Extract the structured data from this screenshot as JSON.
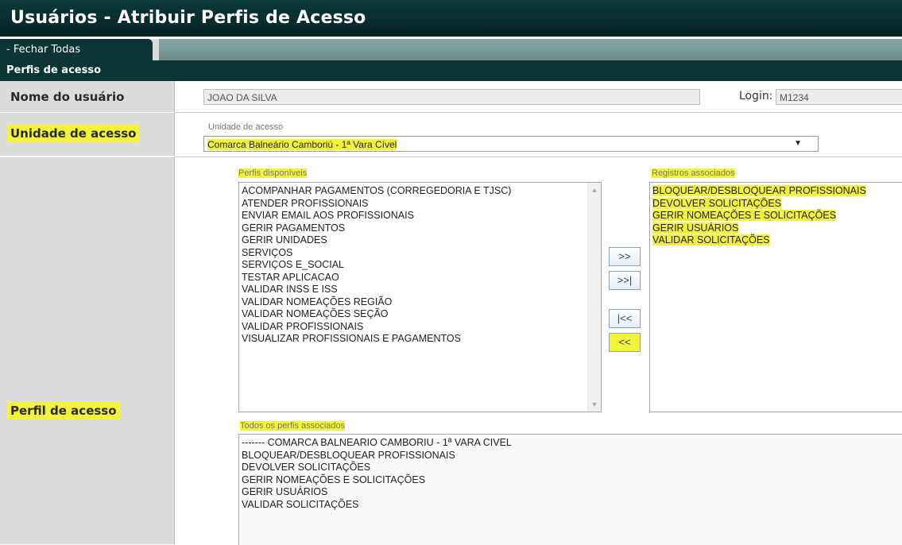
{
  "window": {
    "title": "Usuários - Atribuir Perfis de Acesso"
  },
  "tabs": {
    "close_all": "- Fechar Todas"
  },
  "section": {
    "title": "Perfis de acesso"
  },
  "form": {
    "user_name_label": "Nome do usuário",
    "user_name_value": "JOAO DA SILVA",
    "login_label": "Login:",
    "login_value": "M1234",
    "unit_label": "Unidade de acesso",
    "unit_small_label": "Unidade de acesso",
    "unit_selected": "Comarca Balneário Camboriú - 1ª Vara Cível",
    "profile_label": "Perfil de acesso"
  },
  "available": {
    "label": "Perfis disponíveis",
    "items": [
      "ACOMPANHAR PAGAMENTOS (CORREGEDORIA E TJSC)",
      "ATENDER PROFISSIONAIS",
      "ENVIAR EMAIL AOS PROFISSIONAIS",
      "GERIR PAGAMENTOS",
      "GERIR UNIDADES",
      "SERVIÇOS",
      "SERVIÇOS E_SOCIAL",
      "TESTAR APLICACAO",
      "VALIDAR INSS E ISS",
      "VALIDAR NOMEAÇÕES REGIÃO",
      "VALIDAR NOMEAÇÕES SEÇÃO",
      "VALIDAR PROFISSIONAIS",
      "VISUALIZAR PROFISSIONAIS E PAGAMENTOS"
    ]
  },
  "associated": {
    "label": "Registros associados",
    "items": [
      "BLOQUEAR/DESBLOQUEAR PROFISSIONAIS",
      "DEVOLVER SOLICITAÇÕES",
      "GERIR NOMEAÇÕES E SOLICITAÇÕES",
      "GERIR USUÁRIOS",
      "VALIDAR SOLICITAÇÕES"
    ]
  },
  "buttons": {
    "add": ">>",
    "add_all": ">>|",
    "remove_all": "|<<",
    "remove": "<<"
  },
  "all_associated": {
    "label": "Todos os perfis associados",
    "items": [
      "------- COMARCA BALNEARIO CAMBORIU - 1ª VARA CIVEL",
      "BLOQUEAR/DESBLOQUEAR PROFISSIONAIS",
      "DEVOLVER SOLICITAÇÕES",
      "GERIR NOMEAÇÕES E SOLICITAÇÕES",
      "GERIR USUÁRIOS",
      "VALIDAR SOLICITAÇÕES"
    ]
  },
  "colors": {
    "header_dark": "#0b3535",
    "highlight": "#f3f33a",
    "label_bg": "#dcdcdc"
  }
}
